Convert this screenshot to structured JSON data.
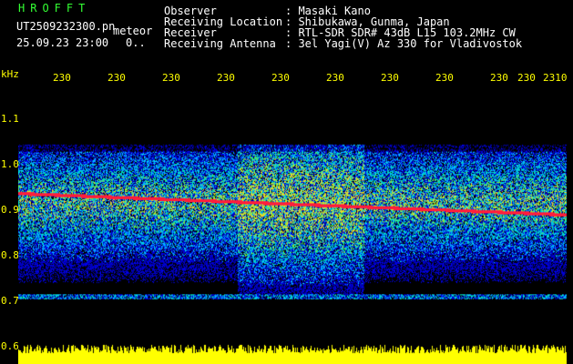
{
  "header": {
    "logo": "HROFFT",
    "filename": "UT2509232300.pn",
    "meteor_label": "meteor",
    "datetime": "25.09.23 23:00",
    "count": "0..",
    "info_rows": [
      {
        "label": "Observer",
        "value": ": Masaki Kano"
      },
      {
        "label": "Receiving Location",
        "value": ": Shibukawa, Gunma, Japan"
      },
      {
        "label": "Receiver",
        "value": ": RTL-SDR SDR# 43dB L15 103.2MHz CW"
      },
      {
        "label": "Receiving Antenna",
        "value": ": 3el Yagi(V) Az 330 for Vladivostok"
      }
    ]
  },
  "axes": {
    "y_unit": "kHz",
    "y_ticks": [
      "1.1",
      "1.0",
      "0.9",
      "0.8",
      "0.7",
      "0.6"
    ],
    "x_ticks": [
      "230",
      "230",
      "230",
      "230",
      "230",
      "230",
      "230",
      "230",
      "230",
      "230",
      "2310"
    ]
  },
  "colors": {
    "background": "#000000",
    "text": "#ffffff",
    "axis": "#ffff00",
    "logo": "#33ff33"
  }
}
